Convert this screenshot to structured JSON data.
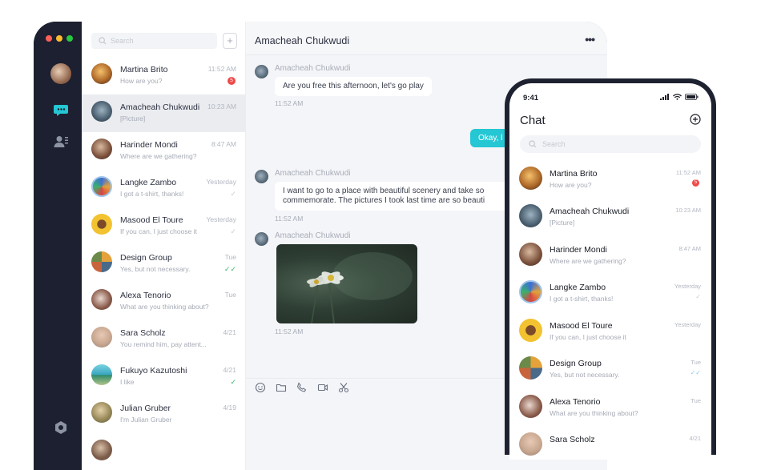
{
  "desktop": {
    "search_placeholder": "Search",
    "chat_title": "Amacheah Chukwudi",
    "conversations": [
      {
        "name": "Martina Brito",
        "preview": "How are you?",
        "time": "11:52 AM",
        "badge": "5"
      },
      {
        "name": "Amacheah Chukwudi",
        "preview": "[Picture]",
        "time": "10:23 AM"
      },
      {
        "name": "Harinder Mondi",
        "preview": "Where are we gathering?",
        "time": "8:47 AM"
      },
      {
        "name": "Langke Zambo",
        "preview": "I got a t-shirt, thanks!",
        "time": "Yesterday"
      },
      {
        "name": "Masood El Toure",
        "preview": "If you can, I just choose it",
        "time": "Yesterday"
      },
      {
        "name": "Design Group",
        "preview": "Yes, but not necessary.",
        "time": "Tue"
      },
      {
        "name": "Alexa Tenorio",
        "preview": "What are you thinking about?",
        "time": "Tue"
      },
      {
        "name": "Sara Scholz",
        "preview": "You remind him, pay attent...",
        "time": "4/21"
      },
      {
        "name": "Fukuyo Kazutoshi",
        "preview": "I like",
        "time": "4/21"
      },
      {
        "name": "Julian Gruber",
        "preview": "I'm Julian Gruber",
        "time": "4/19"
      }
    ],
    "messages": {
      "m1_sender": "Amacheah Chukwudi",
      "m1_text": "Are you free this afternoon, let's go play",
      "m1_time": "11:52 AM",
      "out_text": "Okay, l",
      "m2_sender": "Amacheah Chukwudi",
      "m2_line1": "I want to go to a place with beautiful scenery and take so",
      "m2_line2": "commemorate. The pictures I took last time are so beauti",
      "m2_time": "11:52 AM",
      "m3_sender": "Amacheah Chukwudi",
      "m3_time": "11:52 AM"
    }
  },
  "phone": {
    "status_time": "9:41",
    "title": "Chat",
    "search_placeholder": "Search",
    "conversations": [
      {
        "name": "Martina Brito",
        "preview": "How are you?",
        "time": "11:52 AM",
        "badge": "5"
      },
      {
        "name": "Amacheah Chukwudi",
        "preview": "[Picture]",
        "time": "10:23 AM"
      },
      {
        "name": "Harinder Mondi",
        "preview": "Where are we gathering?",
        "time": "8:47 AM"
      },
      {
        "name": "Langke Zambo",
        "preview": "I got a t-shirt, thanks!",
        "time": "Yesterday"
      },
      {
        "name": "Masood El Toure",
        "preview": "If you can, I just choose it",
        "time": "Yesterday"
      },
      {
        "name": "Design Group",
        "preview": "Yes, but not necessary.",
        "time": "Tue"
      },
      {
        "name": "Alexa Tenorio",
        "preview": "What are you thinking about?",
        "time": "Tue"
      },
      {
        "name": "Sara Scholz",
        "preview": "",
        "time": "4/21"
      }
    ]
  },
  "colors": {
    "accent": "#24c7d3",
    "badge": "#ef4a4a",
    "check_green": "#37b86b",
    "dark_frame": "#1e2230"
  }
}
